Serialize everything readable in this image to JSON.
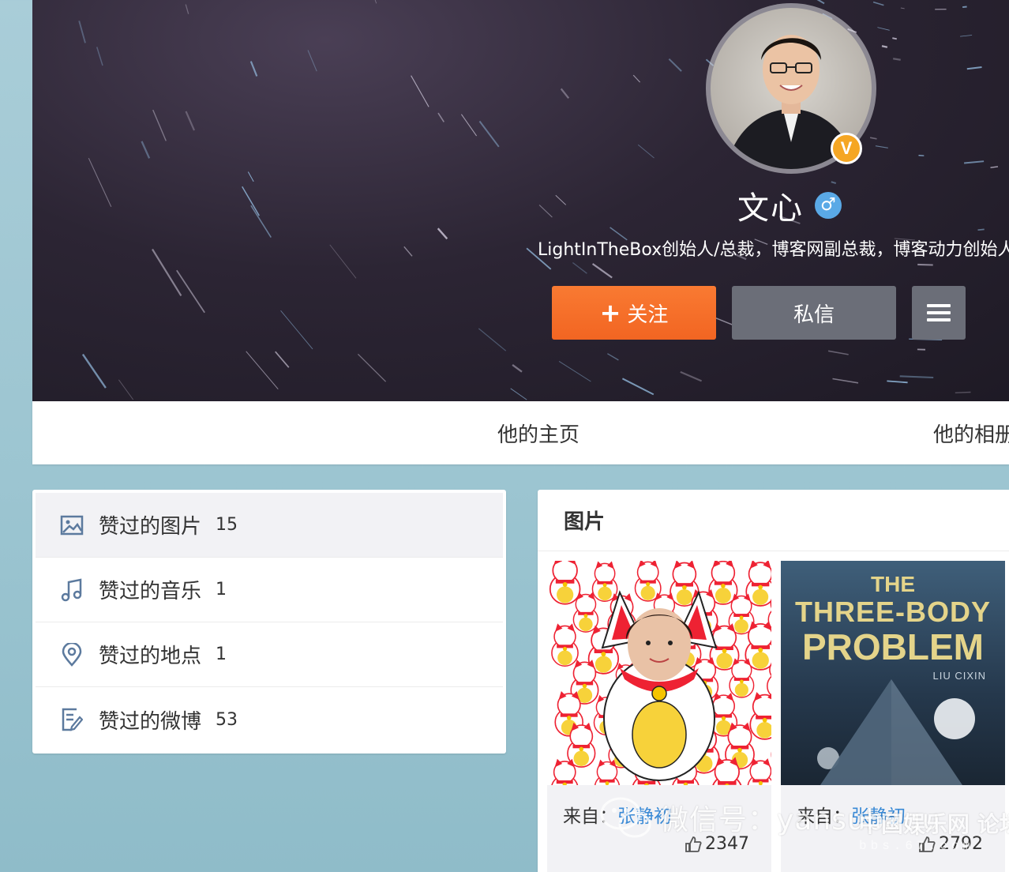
{
  "profile": {
    "name": "文心",
    "verified_badge": "V",
    "gender_symbol": "♂",
    "bio": "LightInTheBox创始人/总裁，博客网副总裁，博客动力创始人",
    "actions": {
      "follow_label": "关注",
      "follow_plus": "+",
      "message_label": "私信"
    }
  },
  "tabs": [
    {
      "label": "他的主页"
    },
    {
      "label": "他的相册"
    }
  ],
  "liked": {
    "items": [
      {
        "label": "赞过的图片",
        "count": "15",
        "icon": "image-icon"
      },
      {
        "label": "赞过的音乐",
        "count": "1",
        "icon": "music-icon"
      },
      {
        "label": "赞过的地点",
        "count": "1",
        "icon": "location-pin-icon"
      },
      {
        "label": "赞过的微博",
        "count": "53",
        "icon": "note-edit-icon"
      }
    ]
  },
  "pictures": {
    "title": "图片",
    "cards": [
      {
        "from_label": "来自：",
        "from_user": "张静初",
        "likes": "2347"
      },
      {
        "from_label": "来自：",
        "from_user": "张静初",
        "likes": "2792",
        "book": {
          "the": "THE",
          "three_body": "THREE-BODY",
          "problem": "PROBLEM",
          "author": "LIU CIXIN"
        }
      }
    ]
  },
  "watermarks": {
    "wechat": "微信号：yansubaqu",
    "site": "中国娱乐网",
    "site_url": "bbs.67.com",
    "forum": "论坛"
  },
  "colors": {
    "follow": "#f26522",
    "secondary_button": "#6b6e78",
    "link": "#3a8ad6",
    "verified": "#f5a623"
  }
}
